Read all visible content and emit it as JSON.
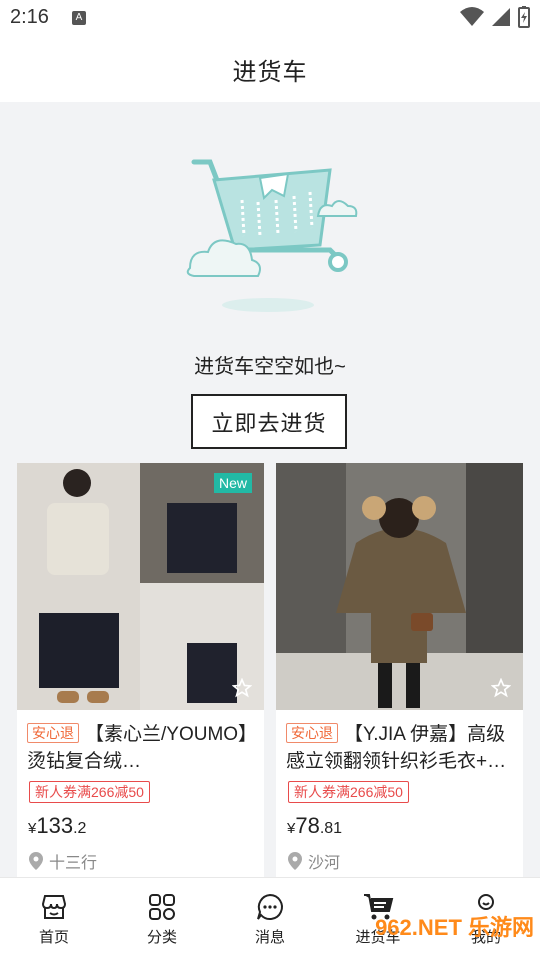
{
  "status": {
    "time": "2:16",
    "a_icon": "A"
  },
  "header": {
    "title": "进货车"
  },
  "empty": {
    "message": "进货车空空如也~",
    "button_label": "立即去进货"
  },
  "products": [
    {
      "badge": "New",
      "safe_tag": "安心退",
      "title": "【素心兰/YOUMO】烫钻复合绒…",
      "coupon": "新人券满266减50",
      "currency": "¥",
      "price_int": "133",
      "price_dec": ".2",
      "location": "十三行"
    },
    {
      "safe_tag": "安心退",
      "title": "【Y.JIA 伊嘉】高级感立领翻领针织衫毛衣+…",
      "coupon": "新人券满266减50",
      "currency": "¥",
      "price_int": "78",
      "price_dec": ".81",
      "location": "沙河"
    }
  ],
  "tabbar": [
    {
      "label": "首页",
      "icon": "shop-icon"
    },
    {
      "label": "分类",
      "icon": "category-icon"
    },
    {
      "label": "消息",
      "icon": "message-icon"
    },
    {
      "label": "进货车",
      "icon": "cart-icon"
    },
    {
      "label": "我的",
      "icon": "profile-icon"
    }
  ],
  "watermark": "962.NET 乐游网",
  "colors": {
    "accent_teal": "#22b9a5",
    "coupon_red": "#e84b4b",
    "safe_orange": "#f06a3a"
  }
}
